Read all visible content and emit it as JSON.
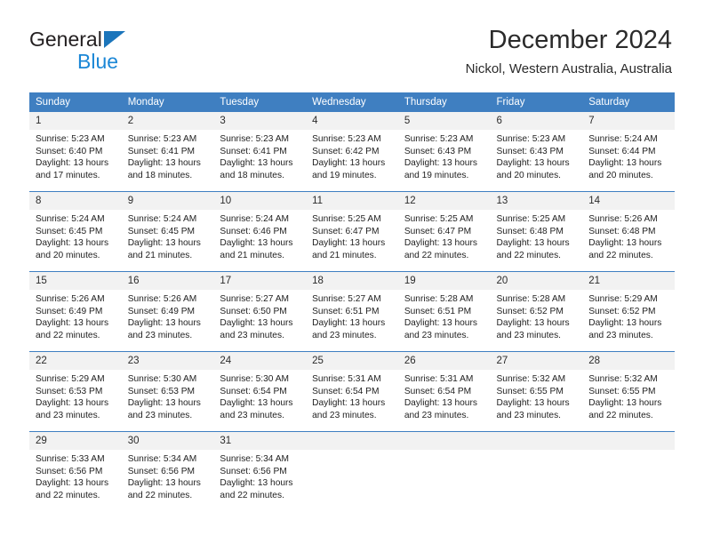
{
  "brand": {
    "name_top": "General",
    "name_bottom": "Blue",
    "triangle_color": "#1b75bb",
    "blue_text_color": "#1b87d6"
  },
  "header": {
    "title": "December 2024",
    "subtitle": "Nickol, Western Australia, Australia"
  },
  "theme": {
    "header_blue": "#3f7fc1",
    "daynum_band": "#f2f2f2",
    "text": "#1f1f1f"
  },
  "weekdays": [
    "Sunday",
    "Monday",
    "Tuesday",
    "Wednesday",
    "Thursday",
    "Friday",
    "Saturday"
  ],
  "weeks": [
    {
      "days": [
        {
          "num": "1",
          "sunrise": "Sunrise: 5:23 AM",
          "sunset": "Sunset: 6:40 PM",
          "daylight": "Daylight: 13 hours and 17 minutes."
        },
        {
          "num": "2",
          "sunrise": "Sunrise: 5:23 AM",
          "sunset": "Sunset: 6:41 PM",
          "daylight": "Daylight: 13 hours and 18 minutes."
        },
        {
          "num": "3",
          "sunrise": "Sunrise: 5:23 AM",
          "sunset": "Sunset: 6:41 PM",
          "daylight": "Daylight: 13 hours and 18 minutes."
        },
        {
          "num": "4",
          "sunrise": "Sunrise: 5:23 AM",
          "sunset": "Sunset: 6:42 PM",
          "daylight": "Daylight: 13 hours and 19 minutes."
        },
        {
          "num": "5",
          "sunrise": "Sunrise: 5:23 AM",
          "sunset": "Sunset: 6:43 PM",
          "daylight": "Daylight: 13 hours and 19 minutes."
        },
        {
          "num": "6",
          "sunrise": "Sunrise: 5:23 AM",
          "sunset": "Sunset: 6:43 PM",
          "daylight": "Daylight: 13 hours and 20 minutes."
        },
        {
          "num": "7",
          "sunrise": "Sunrise: 5:24 AM",
          "sunset": "Sunset: 6:44 PM",
          "daylight": "Daylight: 13 hours and 20 minutes."
        }
      ]
    },
    {
      "days": [
        {
          "num": "8",
          "sunrise": "Sunrise: 5:24 AM",
          "sunset": "Sunset: 6:45 PM",
          "daylight": "Daylight: 13 hours and 20 minutes."
        },
        {
          "num": "9",
          "sunrise": "Sunrise: 5:24 AM",
          "sunset": "Sunset: 6:45 PM",
          "daylight": "Daylight: 13 hours and 21 minutes."
        },
        {
          "num": "10",
          "sunrise": "Sunrise: 5:24 AM",
          "sunset": "Sunset: 6:46 PM",
          "daylight": "Daylight: 13 hours and 21 minutes."
        },
        {
          "num": "11",
          "sunrise": "Sunrise: 5:25 AM",
          "sunset": "Sunset: 6:47 PM",
          "daylight": "Daylight: 13 hours and 21 minutes."
        },
        {
          "num": "12",
          "sunrise": "Sunrise: 5:25 AM",
          "sunset": "Sunset: 6:47 PM",
          "daylight": "Daylight: 13 hours and 22 minutes."
        },
        {
          "num": "13",
          "sunrise": "Sunrise: 5:25 AM",
          "sunset": "Sunset: 6:48 PM",
          "daylight": "Daylight: 13 hours and 22 minutes."
        },
        {
          "num": "14",
          "sunrise": "Sunrise: 5:26 AM",
          "sunset": "Sunset: 6:48 PM",
          "daylight": "Daylight: 13 hours and 22 minutes."
        }
      ]
    },
    {
      "days": [
        {
          "num": "15",
          "sunrise": "Sunrise: 5:26 AM",
          "sunset": "Sunset: 6:49 PM",
          "daylight": "Daylight: 13 hours and 22 minutes."
        },
        {
          "num": "16",
          "sunrise": "Sunrise: 5:26 AM",
          "sunset": "Sunset: 6:49 PM",
          "daylight": "Daylight: 13 hours and 23 minutes."
        },
        {
          "num": "17",
          "sunrise": "Sunrise: 5:27 AM",
          "sunset": "Sunset: 6:50 PM",
          "daylight": "Daylight: 13 hours and 23 minutes."
        },
        {
          "num": "18",
          "sunrise": "Sunrise: 5:27 AM",
          "sunset": "Sunset: 6:51 PM",
          "daylight": "Daylight: 13 hours and 23 minutes."
        },
        {
          "num": "19",
          "sunrise": "Sunrise: 5:28 AM",
          "sunset": "Sunset: 6:51 PM",
          "daylight": "Daylight: 13 hours and 23 minutes."
        },
        {
          "num": "20",
          "sunrise": "Sunrise: 5:28 AM",
          "sunset": "Sunset: 6:52 PM",
          "daylight": "Daylight: 13 hours and 23 minutes."
        },
        {
          "num": "21",
          "sunrise": "Sunrise: 5:29 AM",
          "sunset": "Sunset: 6:52 PM",
          "daylight": "Daylight: 13 hours and 23 minutes."
        }
      ]
    },
    {
      "days": [
        {
          "num": "22",
          "sunrise": "Sunrise: 5:29 AM",
          "sunset": "Sunset: 6:53 PM",
          "daylight": "Daylight: 13 hours and 23 minutes."
        },
        {
          "num": "23",
          "sunrise": "Sunrise: 5:30 AM",
          "sunset": "Sunset: 6:53 PM",
          "daylight": "Daylight: 13 hours and 23 minutes."
        },
        {
          "num": "24",
          "sunrise": "Sunrise: 5:30 AM",
          "sunset": "Sunset: 6:54 PM",
          "daylight": "Daylight: 13 hours and 23 minutes."
        },
        {
          "num": "25",
          "sunrise": "Sunrise: 5:31 AM",
          "sunset": "Sunset: 6:54 PM",
          "daylight": "Daylight: 13 hours and 23 minutes."
        },
        {
          "num": "26",
          "sunrise": "Sunrise: 5:31 AM",
          "sunset": "Sunset: 6:54 PM",
          "daylight": "Daylight: 13 hours and 23 minutes."
        },
        {
          "num": "27",
          "sunrise": "Sunrise: 5:32 AM",
          "sunset": "Sunset: 6:55 PM",
          "daylight": "Daylight: 13 hours and 23 minutes."
        },
        {
          "num": "28",
          "sunrise": "Sunrise: 5:32 AM",
          "sunset": "Sunset: 6:55 PM",
          "daylight": "Daylight: 13 hours and 22 minutes."
        }
      ]
    },
    {
      "days": [
        {
          "num": "29",
          "sunrise": "Sunrise: 5:33 AM",
          "sunset": "Sunset: 6:56 PM",
          "daylight": "Daylight: 13 hours and 22 minutes."
        },
        {
          "num": "30",
          "sunrise": "Sunrise: 5:34 AM",
          "sunset": "Sunset: 6:56 PM",
          "daylight": "Daylight: 13 hours and 22 minutes."
        },
        {
          "num": "31",
          "sunrise": "Sunrise: 5:34 AM",
          "sunset": "Sunset: 6:56 PM",
          "daylight": "Daylight: 13 hours and 22 minutes."
        },
        {
          "num": "",
          "sunrise": "",
          "sunset": "",
          "daylight": ""
        },
        {
          "num": "",
          "sunrise": "",
          "sunset": "",
          "daylight": ""
        },
        {
          "num": "",
          "sunrise": "",
          "sunset": "",
          "daylight": ""
        },
        {
          "num": "",
          "sunrise": "",
          "sunset": "",
          "daylight": ""
        }
      ]
    }
  ]
}
